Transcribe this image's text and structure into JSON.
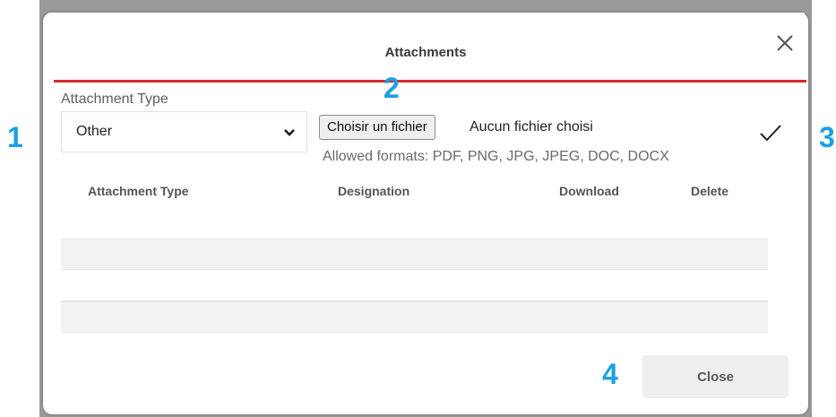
{
  "dialog": {
    "title": "Attachments",
    "close_icon": "close-icon",
    "accent_color": "#d62b2b"
  },
  "form": {
    "attachment_type_label": "Attachment Type",
    "attachment_type_value": "Other",
    "file_button_label": "Choisir un fichier",
    "file_status": "Aucun fichier choisi",
    "allowed_formats": "Allowed formats: PDF, PNG, JPG, JPEG, DOC, DOCX",
    "confirm_icon": "check-icon"
  },
  "table": {
    "columns": [
      "Attachment Type",
      "Designation",
      "Download",
      "Delete"
    ],
    "rows": []
  },
  "footer": {
    "close_label": "Close"
  },
  "callouts": {
    "one": "1",
    "two": "2",
    "three": "3",
    "four": "4",
    "color": "#1ba1e2"
  }
}
